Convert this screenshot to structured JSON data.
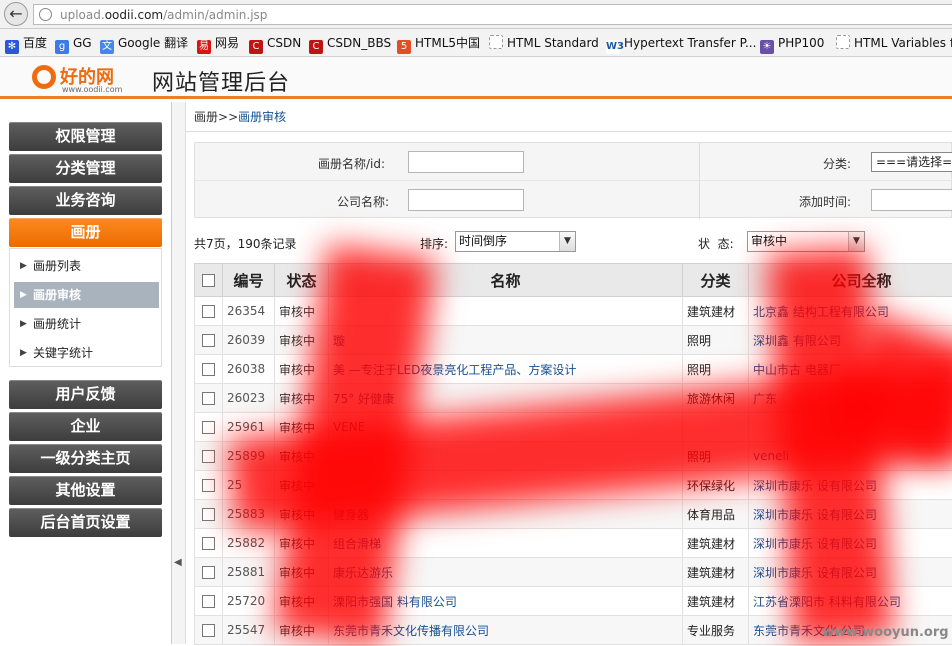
{
  "browser": {
    "url_prefix": "upload.",
    "url_domain": "oodii.com",
    "url_path": "/admin/admin.jsp",
    "bookmarks": [
      {
        "label": "百度",
        "icon": "baidu-paw-icon",
        "color": "#2b58d9"
      },
      {
        "label": "GG",
        "icon": "google-g-icon",
        "color": "#3b7be8"
      },
      {
        "label": "Google 翻译",
        "icon": "google-translate-icon",
        "color": "#4a86e8"
      },
      {
        "label": "网易",
        "icon": "netease-icon",
        "color": "#d61515"
      },
      {
        "label": "CSDN",
        "icon": "csdn-icon",
        "color": "#c01414"
      },
      {
        "label": "CSDN_BBS",
        "icon": "csdn-icon",
        "color": "#c01414"
      },
      {
        "label": "HTML5中国",
        "icon": "html5-icon",
        "color": "#e44d26"
      },
      {
        "label": "HTML Standard",
        "icon": "page-icon",
        "color": "#999999"
      },
      {
        "label": "Hypertext Transfer P...",
        "icon": "w3c-icon",
        "color": "#1a5aa8"
      },
      {
        "label": "PHP100",
        "icon": "php100-icon",
        "color": "#6a4fa8"
      },
      {
        "label": "HTML Variables f",
        "icon": "page-icon",
        "color": "#999999"
      }
    ]
  },
  "header": {
    "logo_cn": "好的网",
    "logo_url": "www.oodii.com",
    "title": "网站管理后台",
    "accent": "#ef7d22"
  },
  "sidebar": {
    "top_menu": [
      "权限管理",
      "分类管理",
      "业务咨询"
    ],
    "active_menu": "画册",
    "submenu": [
      {
        "label": "画册列表",
        "selected": false
      },
      {
        "label": "画册审核",
        "selected": true
      },
      {
        "label": "画册统计",
        "selected": false
      },
      {
        "label": "关键字统计",
        "selected": false
      }
    ],
    "bottom_menu": [
      "用户反馈",
      "企业",
      "一级分类主页",
      "其他设置",
      "后台首页设置"
    ]
  },
  "breadcrumb": {
    "root": "画册",
    "sep": ">>",
    "current": "画册审核"
  },
  "filter": {
    "name_label": "画册名称/id:",
    "category_label": "分类:",
    "category_value": "===请选择===",
    "company_label": "公司名称:",
    "added_label": "添加时间:"
  },
  "toolbar": {
    "summary": "共7页，190条记录",
    "sort_label": "排序:",
    "sort_value": "时间倒序",
    "status_label": "状  态:",
    "status_value": "审核中"
  },
  "table": {
    "headers": [
      "编号",
      "状态",
      "名称",
      "分类",
      "公司全称"
    ],
    "rows": [
      {
        "id": "26354",
        "status": "审核中",
        "name": "",
        "category": "建筑建材",
        "company": "北京鑫       结构工程有限公司"
      },
      {
        "id": "26039",
        "status": "审核中",
        "name": "璇",
        "category": "照明",
        "company": "深圳鑫         有限公司"
      },
      {
        "id": "26038",
        "status": "审核中",
        "name": "美         —专注于LED夜景亮化工程产品、方案设计",
        "category": "照明",
        "company": "中山市古          电器厂"
      },
      {
        "id": "26023",
        "status": "审核中",
        "name": "75°        好健康",
        "category": "旅游休闲",
        "company": "广东"
      },
      {
        "id": "25961",
        "status": "审核中",
        "name": "VENE",
        "category": "",
        "company": ""
      },
      {
        "id": "25899",
        "status": "审核中",
        "name": "",
        "category": "照明",
        "company": "veneli"
      },
      {
        "id": "25",
        "status": "审核中",
        "name": "",
        "category": "环保绿化",
        "company": "深圳市康乐        设有限公司"
      },
      {
        "id": "25883",
        "status": "审核中",
        "name": "健身器",
        "category": "体育用品",
        "company": "深圳市康乐        设有限公司"
      },
      {
        "id": "25882",
        "status": "审核中",
        "name": "组合滑梯",
        "category": "建筑建材",
        "company": "深圳市康乐        设有限公司"
      },
      {
        "id": "25881",
        "status": "审核中",
        "name": "康乐达游乐",
        "category": "建筑建材",
        "company": "深圳市康乐        设有限公司"
      },
      {
        "id": "25720",
        "status": "审核中",
        "name": "溧阳市强国        料有限公司",
        "category": "建筑建材",
        "company": "江苏省溧阳市        科料有限公司"
      },
      {
        "id": "25547",
        "status": "审核中",
        "name": "东莞市青禾文化传播有限公司",
        "category": "专业服务",
        "company": "东莞市青禾文化        公司"
      }
    ]
  },
  "watermark": "www.wooyun.org",
  "redaction_color": "#ff0000"
}
